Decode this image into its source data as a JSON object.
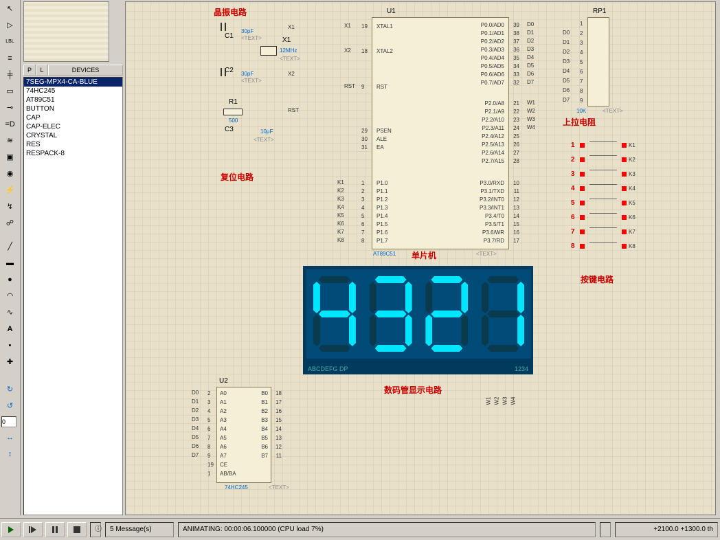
{
  "devices_header": "DEVICES",
  "pl_buttons": [
    "P",
    "L"
  ],
  "device_list": [
    "7SEG-MPX4-CA-BLUE",
    "74HC245",
    "AT89C51",
    "BUTTON",
    "CAP",
    "CAP-ELEC",
    "CRYSTAL",
    "RES",
    "RESPACK-8"
  ],
  "annotations": {
    "osc": "晶振电路",
    "reset": "复位电路",
    "mcu": "单片机",
    "display": "数码管显示电路",
    "pullup": "上拉电阻",
    "keys": "按键电路"
  },
  "refs": {
    "u1": "U1",
    "u2": "U2",
    "rp1": "RP1",
    "x1": "X1",
    "c1": "C1",
    "c2": "C2",
    "c3": "C3",
    "r1": "R1",
    "mcu_part": "AT89C51",
    "u2_part": "74HC245",
    "x1_val": "12MHz",
    "rp1_val": "10K",
    "c12_val": "30pF",
    "c3_val": "10µF",
    "r1_val": "500",
    "text_ph": "<TEXT>"
  },
  "mcu_pins_left": [
    {
      "n": "19",
      "t": "XTAL1"
    },
    {
      "n": "18",
      "t": "XTAL2"
    },
    {
      "n": "9",
      "t": "RST"
    },
    {
      "n": "29",
      "t": "PSEN"
    },
    {
      "n": "30",
      "t": "ALE"
    },
    {
      "n": "31",
      "t": "EA"
    },
    {
      "n": "1",
      "t": "P1.0"
    },
    {
      "n": "2",
      "t": "P1.1"
    },
    {
      "n": "3",
      "t": "P1.2"
    },
    {
      "n": "4",
      "t": "P1.3"
    },
    {
      "n": "5",
      "t": "P1.4"
    },
    {
      "n": "6",
      "t": "P1.5"
    },
    {
      "n": "7",
      "t": "P1.6"
    },
    {
      "n": "8",
      "t": "P1.7"
    }
  ],
  "mcu_pins_right": [
    {
      "n": "39",
      "t": "P0.0/AD0"
    },
    {
      "n": "38",
      "t": "P0.1/AD1"
    },
    {
      "n": "37",
      "t": "P0.2/AD2"
    },
    {
      "n": "36",
      "t": "P0.3/AD3"
    },
    {
      "n": "35",
      "t": "P0.4/AD4"
    },
    {
      "n": "34",
      "t": "P0.5/AD5"
    },
    {
      "n": "33",
      "t": "P0.6/AD6"
    },
    {
      "n": "32",
      "t": "P0.7/AD7"
    },
    {
      "n": "21",
      "t": "P2.0/A8"
    },
    {
      "n": "22",
      "t": "P2.1/A9"
    },
    {
      "n": "23",
      "t": "P2.2/A10"
    },
    {
      "n": "24",
      "t": "P2.3/A11"
    },
    {
      "n": "25",
      "t": "P2.4/A12"
    },
    {
      "n": "26",
      "t": "P2.5/A13"
    },
    {
      "n": "27",
      "t": "P2.6/A14"
    },
    {
      "n": "28",
      "t": "P2.7/A15"
    },
    {
      "n": "10",
      "t": "P3.0/RXD"
    },
    {
      "n": "11",
      "t": "P3.1/TXD"
    },
    {
      "n": "12",
      "t": "P3.2/INT0"
    },
    {
      "n": "13",
      "t": "P3.3/INT1"
    },
    {
      "n": "14",
      "t": "P3.4/T0"
    },
    {
      "n": "15",
      "t": "P3.5/T1"
    },
    {
      "n": "16",
      "t": "P3.6/WR"
    },
    {
      "n": "17",
      "t": "P3.7/RD"
    }
  ],
  "u2_left": [
    {
      "n": "2",
      "t": "A0"
    },
    {
      "n": "3",
      "t": "A1"
    },
    {
      "n": "4",
      "t": "A2"
    },
    {
      "n": "5",
      "t": "A3"
    },
    {
      "n": "6",
      "t": "A4"
    },
    {
      "n": "7",
      "t": "A5"
    },
    {
      "n": "8",
      "t": "A6"
    },
    {
      "n": "9",
      "t": "A7"
    },
    {
      "n": "19",
      "t": "CE"
    },
    {
      "n": "1",
      "t": "AB/BA"
    }
  ],
  "u2_right": [
    {
      "n": "18",
      "t": "B0"
    },
    {
      "n": "17",
      "t": "B1"
    },
    {
      "n": "16",
      "t": "B2"
    },
    {
      "n": "15",
      "t": "B3"
    },
    {
      "n": "14",
      "t": "B4"
    },
    {
      "n": "13",
      "t": "B5"
    },
    {
      "n": "12",
      "t": "B6"
    },
    {
      "n": "11",
      "t": "B7"
    }
  ],
  "nets_x": [
    "X1",
    "X2",
    "RST"
  ],
  "nets_k": [
    "K1",
    "K2",
    "K3",
    "K4",
    "K5",
    "K6",
    "K7",
    "K8"
  ],
  "nets_d": [
    "D0",
    "D1",
    "D2",
    "D3",
    "D4",
    "D5",
    "D6",
    "D7"
  ],
  "nets_w": [
    "W1",
    "W2",
    "W3",
    "W4"
  ],
  "disp_foot_left": "ABCDEFG DP",
  "disp_foot_right": "1234",
  "digits": "4321",
  "rp1_pins": [
    "1",
    "2",
    "3",
    "4",
    "5",
    "6",
    "7",
    "8",
    "9"
  ],
  "keys": [
    {
      "i": "1",
      "l": "K1"
    },
    {
      "i": "2",
      "l": "K2"
    },
    {
      "i": "3",
      "l": "K3"
    },
    {
      "i": "4",
      "l": "K4"
    },
    {
      "i": "5",
      "l": "K5"
    },
    {
      "i": "6",
      "l": "K6"
    },
    {
      "i": "7",
      "l": "K7"
    },
    {
      "i": "8",
      "l": "K8"
    }
  ],
  "status": {
    "messages": "5 Message(s)",
    "anim": "ANIMATING: 00:00:06.100000 (CPU load 7%)",
    "coords": "+2100.0  +1300.0   th"
  },
  "spin_val": "0"
}
